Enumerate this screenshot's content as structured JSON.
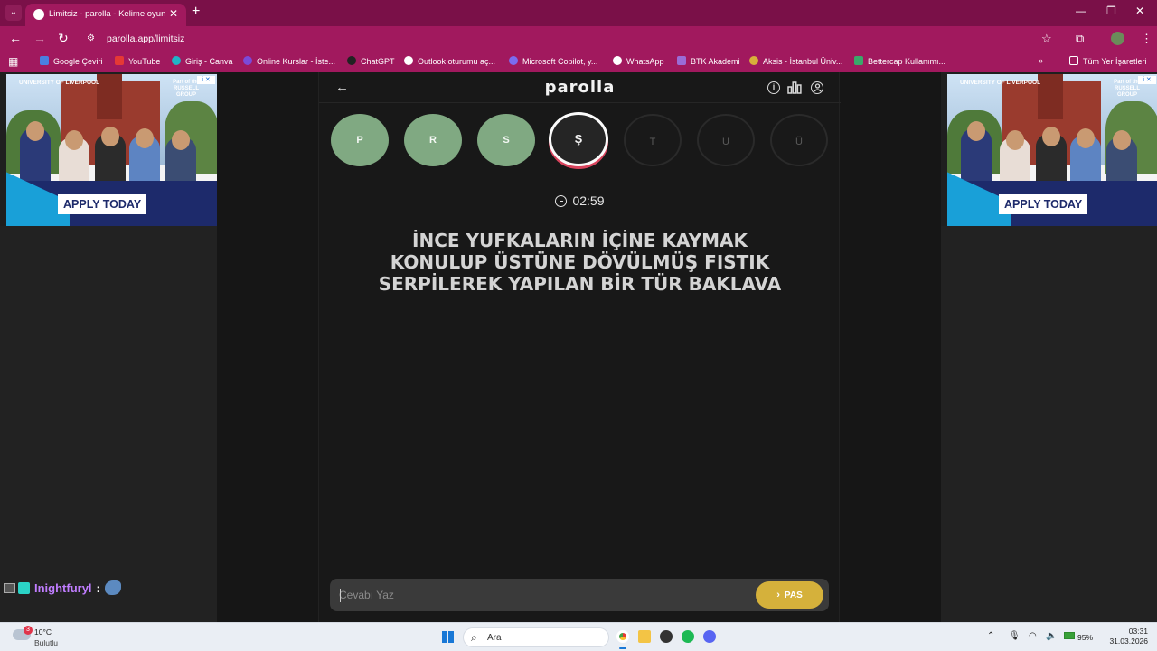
{
  "browser": {
    "tab_title": "Limitsiz - parolla - Kelime oyunu",
    "url": "parolla.app/limitsiz",
    "bookmarks": [
      {
        "label": "Google Çeviri",
        "color": "#4a7fe0"
      },
      {
        "label": "YouTube",
        "color": "#e53935"
      },
      {
        "label": "Giriş - Canva",
        "color": "#20b3c7"
      },
      {
        "label": "Online Kurslar - İste...",
        "color": "#7b4ad8"
      },
      {
        "label": "ChatGPT",
        "color": "#222222"
      },
      {
        "label": "Outlook oturumu aç...",
        "color": "#ffffff"
      },
      {
        "label": "Microsoft Copilot, y...",
        "color": "#7a6cf0"
      },
      {
        "label": "WhatsApp",
        "color": "#ffffff"
      },
      {
        "label": "BTK Akademi",
        "color": "#9a6cd6"
      },
      {
        "label": "Aksis - İstanbul Üniv...",
        "color": "#d8b03a"
      },
      {
        "label": "Bettercap Kullanımı...",
        "color": "#3aa86a"
      }
    ],
    "all_bookmarks_label": "Tüm Yer İşaretleri"
  },
  "ads": {
    "apply_label": "APPLY TODAY",
    "logo_text": "UNIVERSITY OF LIVERPOOL",
    "group_text": "Part of the RUSSELL GROUP"
  },
  "game": {
    "brand": "parolla",
    "letters": [
      {
        "letter": "P",
        "state": "done"
      },
      {
        "letter": "R",
        "state": "done"
      },
      {
        "letter": "S",
        "state": "done"
      },
      {
        "letter": "Ş",
        "state": "active"
      },
      {
        "letter": "T",
        "state": "todo"
      },
      {
        "letter": "U",
        "state": "todo"
      },
      {
        "letter": "Ü",
        "state": "todo"
      }
    ],
    "timer": "02:59",
    "question": "İNCE YUFKALARIN İÇİNE KAYMAK KONULUP ÜSTÜNE DÖVÜLMÜŞ FISTIK SERPİLEREK YAPILAN BİR TÜR BAKLAVA",
    "answer_placeholder": "Cevabı Yaz",
    "pass_label": "PAS",
    "colors": {
      "done": "#80a982",
      "active_ring": "#d9445d",
      "pass": "#d5b13b"
    }
  },
  "chat": {
    "username": "Inightfuryl",
    "separator": ":"
  },
  "taskbar": {
    "weather_temp": "10°C",
    "weather_desc": "Bulutlu",
    "weather_badge": "3",
    "search_label": "Ara",
    "battery": "95%",
    "time": "03:31",
    "date": "31.03.2026"
  }
}
